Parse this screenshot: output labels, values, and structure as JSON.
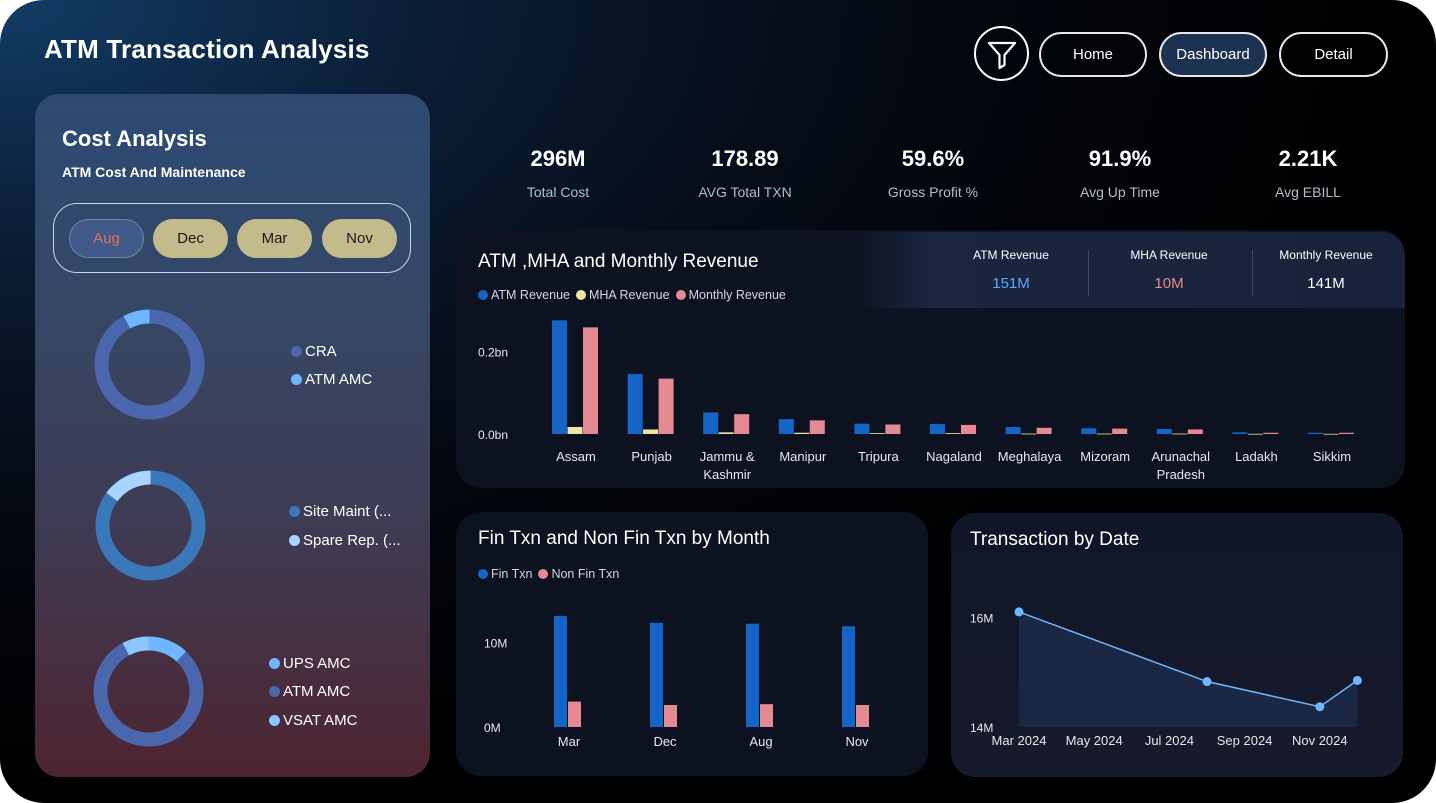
{
  "header": {
    "title": "ATM Transaction Analysis",
    "nav": {
      "home": "Home",
      "dashboard": "Dashboard",
      "detail": "Detail"
    },
    "filter_icon": "filter-funnel-icon"
  },
  "cost_panel": {
    "title": "Cost Analysis",
    "subtitle": "ATM Cost And Maintenance",
    "months": [
      "Aug",
      "Dec",
      "Mar",
      "Nov"
    ],
    "selected_month": "Aug",
    "donuts": [
      {
        "slices": [
          {
            "label": "CRA",
            "value": 92,
            "color": "#4a66ad"
          },
          {
            "label": "ATM AMC",
            "value": 8,
            "color": "#6fb6ff"
          }
        ]
      },
      {
        "slices": [
          {
            "label": "Site Maint (...",
            "value": 85,
            "color": "#3b78ba"
          },
          {
            "label": "Spare Rep. (...",
            "value": 15,
            "color": "#a9d4ff"
          }
        ]
      },
      {
        "slices": [
          {
            "label": "UPS AMC",
            "value": 12,
            "color": "#6fb6ff"
          },
          {
            "label": "ATM AMC",
            "value": 80,
            "color": "#4a66ad"
          },
          {
            "label": "VSAT AMC",
            "value": 8,
            "color": "#8cc6ff"
          }
        ]
      }
    ]
  },
  "kpis": [
    {
      "value": "296M",
      "label": "Total Cost"
    },
    {
      "value": "178.89",
      "label": "AVG Total TXN"
    },
    {
      "value": "59.6%",
      "label": "Gross Profit %"
    },
    {
      "value": "91.9%",
      "label": "Avg Up Time"
    },
    {
      "value": "2.21K",
      "label": "Avg EBILL"
    }
  ],
  "revenue_cards": [
    {
      "label": "ATM Revenue",
      "value": "151M",
      "color": "#5aa6ff"
    },
    {
      "label": "MHA Revenue",
      "value": "10M",
      "color": "#e58a92"
    },
    {
      "label": "Monthly Revenue",
      "value": "141M",
      "color": "#ffffff"
    }
  ],
  "colors": {
    "atm": "#1565c8",
    "mha": "#efe3a3",
    "monthly": "#e58a92",
    "fin": "#1565c8",
    "nonfin": "#e58a92",
    "line": "#6fb6ff"
  },
  "chart_data": [
    {
      "type": "bar",
      "title": "ATM ,MHA and Monthly Revenue",
      "categories": [
        "Assam",
        "Punjab",
        "Jammu & Kashmir",
        "Manipur",
        "Tripura",
        "Nagaland",
        "Meghalaya",
        "Mizoram",
        "Arunachal Pradesh",
        "Ladakh",
        "Sikkim"
      ],
      "series": [
        {
          "name": "ATM Revenue",
          "values": [
            0.275,
            0.145,
            0.052,
            0.036,
            0.025,
            0.024,
            0.017,
            0.014,
            0.012,
            0.004,
            0.003
          ]
        },
        {
          "name": "MHA Revenue",
          "values": [
            0.017,
            0.011,
            0.004,
            0.003,
            0.002,
            0.002,
            0.001,
            0.001,
            0.001,
            0.0005,
            0.0005
          ]
        },
        {
          "name": "Monthly Revenue",
          "values": [
            0.258,
            0.134,
            0.048,
            0.033,
            0.023,
            0.022,
            0.015,
            0.013,
            0.011,
            0.003,
            0.003
          ]
        }
      ],
      "yticks": [
        "0.0bn",
        "0.2bn"
      ],
      "ylim": [
        0,
        0.3
      ]
    },
    {
      "type": "bar",
      "title": "Fin Txn and Non Fin Txn by Month",
      "categories": [
        "Mar",
        "Dec",
        "Aug",
        "Nov"
      ],
      "series": [
        {
          "name": "Fin Txn",
          "values": [
            13.1,
            12.3,
            12.2,
            11.9
          ]
        },
        {
          "name": "Non Fin Txn",
          "values": [
            3.0,
            2.6,
            2.7,
            2.6
          ]
        }
      ],
      "yticks": [
        "0M",
        "10M"
      ],
      "ylim": [
        0,
        15
      ]
    },
    {
      "type": "area",
      "title": "Transaction by Date",
      "x": [
        "Mar 2024",
        "Aug 2024",
        "Nov 2024",
        "Dec 2024"
      ],
      "values": [
        16.1,
        14.83,
        14.37,
        14.85
      ],
      "xticks": [
        "Mar 2024",
        "May 2024",
        "Jul 2024",
        "Sep 2024",
        "Nov 2024"
      ],
      "yticks": [
        "14M",
        "16M"
      ],
      "ylim": [
        14,
        16.5
      ]
    }
  ]
}
